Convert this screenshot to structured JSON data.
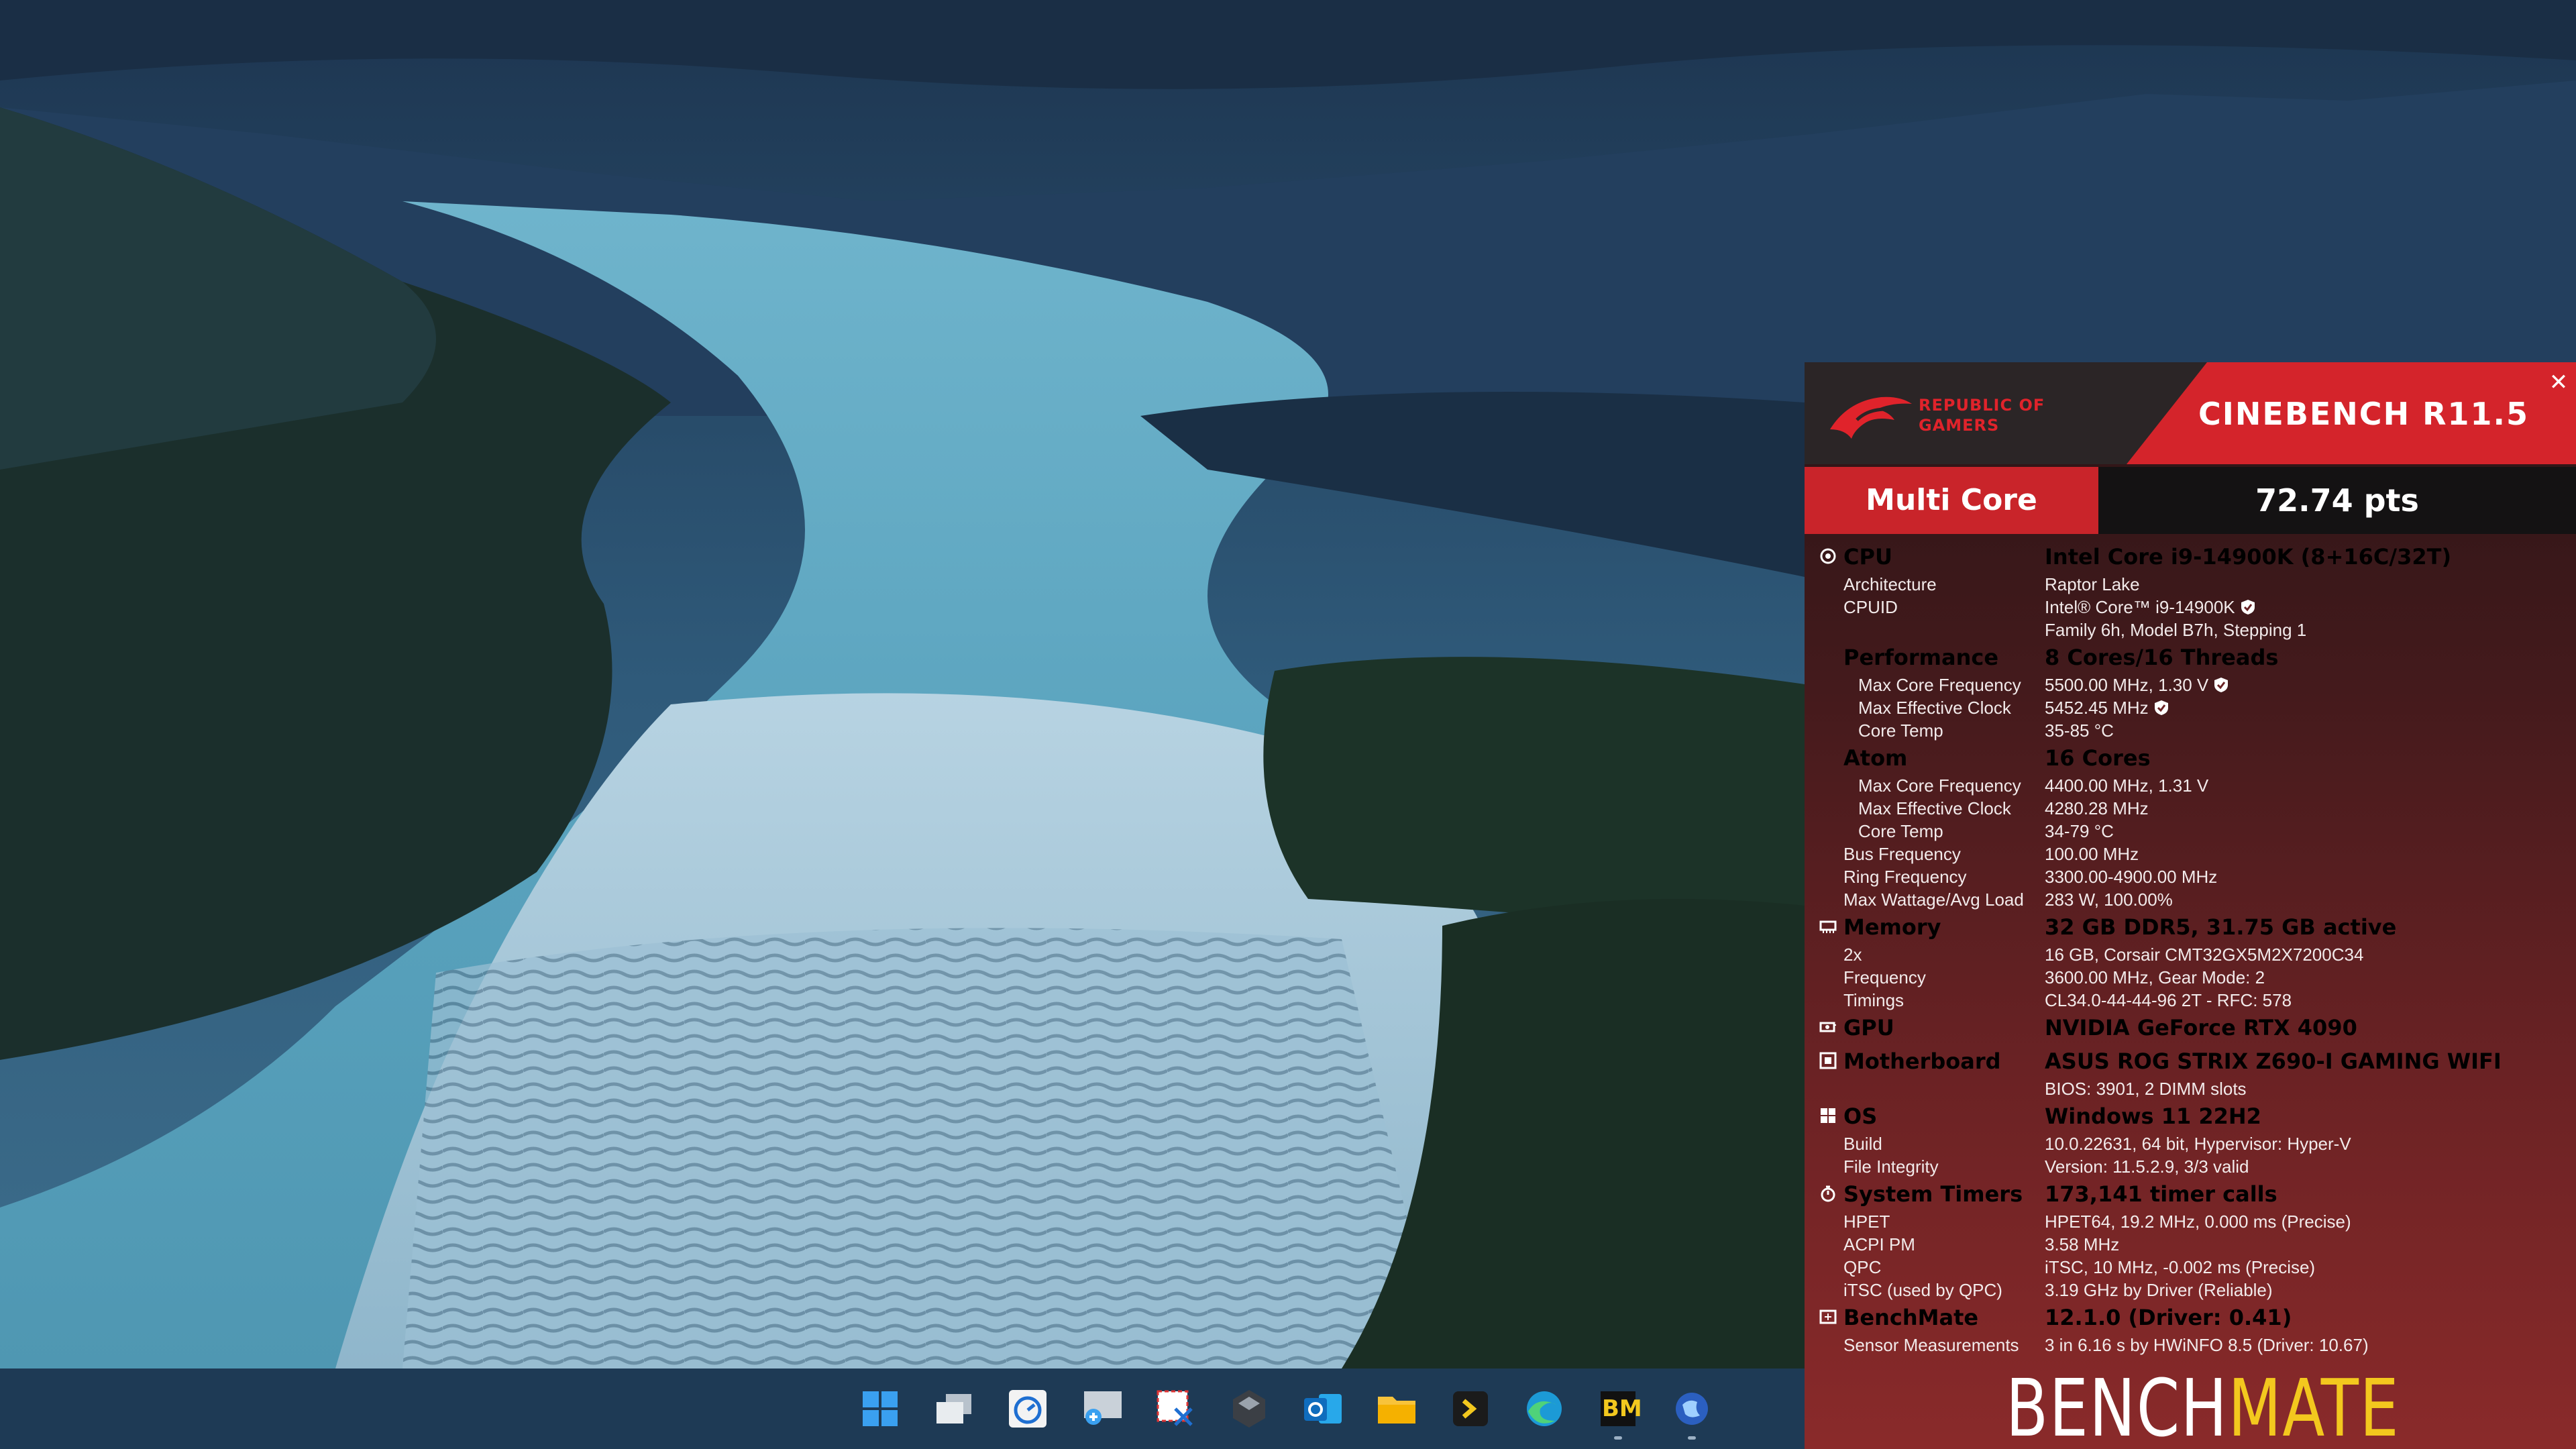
{
  "header": {
    "rog_line1": "REPUBLIC OF",
    "rog_line2": "GAMERS",
    "title": "CINEBENCH R11.5",
    "close": "✕"
  },
  "score": {
    "label": "Multi Core",
    "value": "72.74 pts"
  },
  "cpu": {
    "label": "CPU",
    "value": "Intel Core i9-14900K (8+16C/32T)",
    "architecture_label": "Architecture",
    "architecture": "Raptor Lake",
    "cpuid_label": "CPUID",
    "cpuid": "Intel® Core™ i9-14900K",
    "cpuid_detail": "Family 6h, Model B7h, Stepping 1"
  },
  "performance": {
    "label": "Performance",
    "value": "8 Cores/16 Threads",
    "max_core_freq_label": "Max Core Frequency",
    "max_core_freq": "5500.00 MHz, 1.30 V",
    "max_eff_clock_label": "Max Effective Clock",
    "max_eff_clock": "5452.45 MHz",
    "core_temp_label": "Core Temp",
    "core_temp": "35-85 °C"
  },
  "atom": {
    "label": "Atom",
    "value": "16 Cores",
    "max_core_freq_label": "Max Core Frequency",
    "max_core_freq": "4400.00 MHz, 1.31 V",
    "max_eff_clock_label": "Max Effective Clock",
    "max_eff_clock": "4280.28 MHz",
    "core_temp_label": "Core Temp",
    "core_temp": "34-79 °C"
  },
  "misc": {
    "bus_label": "Bus Frequency",
    "bus": "100.00 MHz",
    "ring_label": "Ring Frequency",
    "ring": "3300.00-4900.00 MHz",
    "watt_label": "Max Wattage/Avg Load",
    "watt": "283 W, 100.00%"
  },
  "memory": {
    "label": "Memory",
    "value": "32 GB DDR5, 31.75 GB active",
    "count_label": "2x",
    "count": "16 GB, Corsair CMT32GX5M2X7200C34",
    "freq_label": "Frequency",
    "freq": "3600.00 MHz, Gear Mode: 2",
    "timings_label": "Timings",
    "timings": "CL34.0-44-44-96 2T - RFC: 578"
  },
  "gpu": {
    "label": "GPU",
    "value": "NVIDIA GeForce RTX 4090"
  },
  "motherboard": {
    "label": "Motherboard",
    "value": "ASUS ROG STRIX Z690-I GAMING WIFI",
    "bios": "BIOS: 3901, 2 DIMM slots"
  },
  "os": {
    "label": "OS",
    "value": "Windows 11 22H2",
    "build_label": "Build",
    "build": "10.0.22631, 64 bit, Hypervisor: Hyper-V",
    "integrity_label": "File Integrity",
    "integrity": "Version: 11.5.2.9, 3/3 valid"
  },
  "timers": {
    "label": "System Timers",
    "value": "173,141 timer calls",
    "hpet_label": "HPET",
    "hpet": "HPET64, 19.2 MHz, 0.000 ms (Precise)",
    "acpi_label": "ACPI PM",
    "acpi": "3.58 MHz",
    "qpc_label": "QPC",
    "qpc": "iTSC, 10 MHz, -0.002 ms (Precise)",
    "itsc_label": "iTSC (used by QPC)",
    "itsc": "3.19 GHz by Driver (Reliable)"
  },
  "benchmate": {
    "label": "BenchMate",
    "value": "12.1.0 (Driver: 0.41)",
    "sensor_label": "Sensor Measurements",
    "sensor": "3 in 6.16 s by HWiNFO 8.5 (Driver: 10.67)",
    "logo_bench": "BENCH",
    "logo_mate": "MATE"
  },
  "taskbar": {
    "icons": [
      "windows-start-icon",
      "task-view-icon",
      "clock-app-icon",
      "magnifier-icon",
      "snipping-tool-icon",
      "obs-icon",
      "outlook-icon",
      "file-explorer-icon",
      "terminal-icon",
      "edge-icon",
      "benchmate-icon",
      "globe-app-icon"
    ],
    "bm_label": "BM"
  }
}
